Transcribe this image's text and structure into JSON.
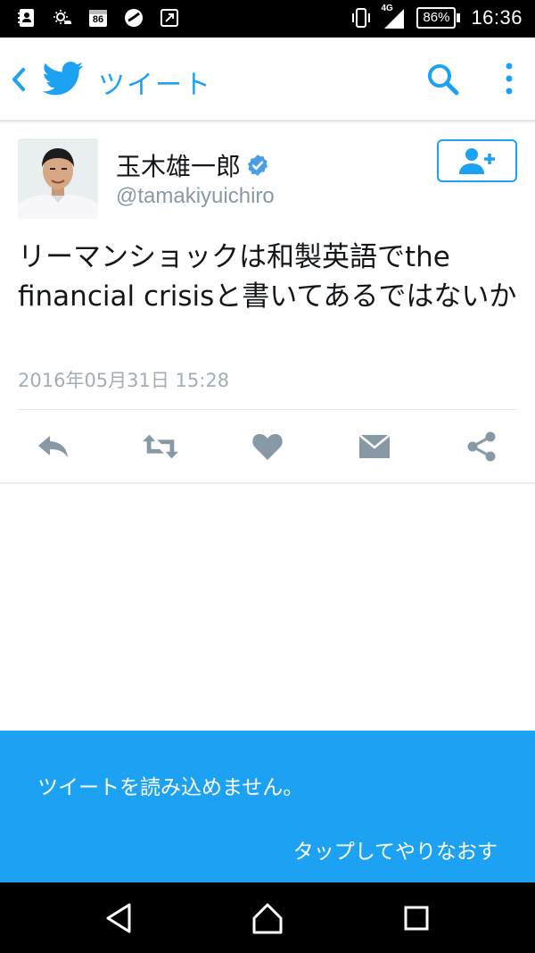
{
  "status_bar": {
    "time": "16:36",
    "battery": "86%",
    "network": "4G",
    "notification_badge": "86"
  },
  "app_bar": {
    "title": "ツイート",
    "back_icon": "chevron-left-icon",
    "logo_icon": "twitter-bird-icon",
    "search_icon": "search-icon",
    "menu_icon": "more-vert-icon"
  },
  "tweet": {
    "user_name": "玉木雄一郎",
    "handle": "@tamakiyuichiro",
    "verified": true,
    "text": "リーマンショックは和製英語でthe financial crisisと書いてあるではないか",
    "timestamp": "2016年05月31日 15:28"
  },
  "actions": [
    {
      "name": "reply",
      "icon": "reply-icon"
    },
    {
      "name": "retweet",
      "icon": "retweet-icon"
    },
    {
      "name": "like",
      "icon": "heart-icon"
    },
    {
      "name": "direct-message",
      "icon": "envelope-icon"
    },
    {
      "name": "share",
      "icon": "share-icon"
    }
  ],
  "error_banner": {
    "message": "ツイートを読み込めません。",
    "retry_label": "タップしてやりなおす"
  },
  "colors": {
    "accent": "#1da1f2",
    "icon_gray": "#8899a6",
    "text": "#14171a",
    "muted": "#a2adb6"
  }
}
